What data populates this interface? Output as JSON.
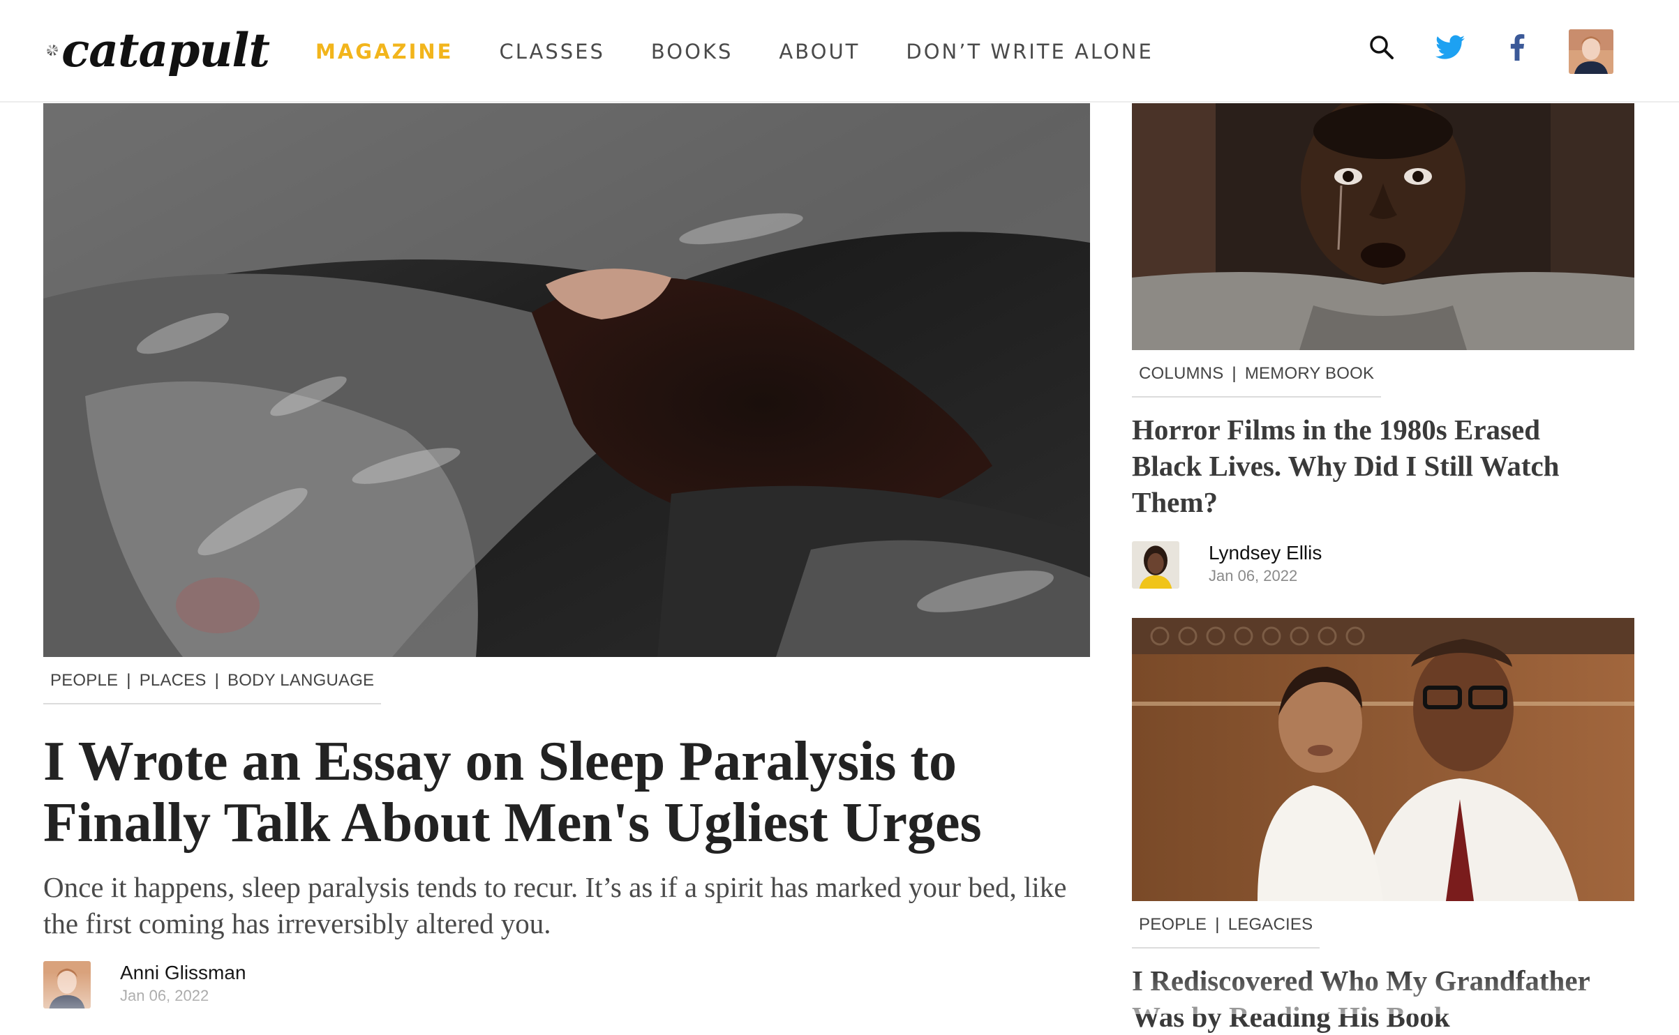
{
  "header": {
    "logo_text": "catapult",
    "nav": [
      {
        "label": "MAGAZINE",
        "active": true
      },
      {
        "label": "CLASSES",
        "active": false
      },
      {
        "label": "BOOKS",
        "active": false
      },
      {
        "label": "ABOUT",
        "active": false
      },
      {
        "label": "DON’T WRITE ALONE",
        "active": false
      }
    ],
    "icons": [
      "search-icon",
      "twitter-icon",
      "facebook-icon",
      "user-avatar"
    ]
  },
  "hero": {
    "tags": [
      "PEOPLE",
      "PLACES",
      "BODY LANGUAGE"
    ],
    "title": "I Wrote an Essay on Sleep Paralysis to Finally Talk About Men's Ugliest Urges",
    "dek": "Once it happens, sleep paralysis tends to recur. It’s as if a spirit has marked your bed, like the first coming has irreversibly altered you.",
    "author": {
      "name": "Anni Glissman",
      "date": "Jan 06, 2022"
    }
  },
  "sidebar": [
    {
      "tags": [
        "COLUMNS",
        "MEMORY BOOK"
      ],
      "title": "Horror Films in the 1980s Erased Black Lives. Why Did I Still Watch Them?",
      "author": {
        "name": "Lyndsey Ellis",
        "date": "Jan 06, 2022"
      }
    },
    {
      "tags": [
        "PEOPLE",
        "LEGACIES"
      ],
      "title": "I Rediscovered Who My Grandfather Was by Reading His Book"
    }
  ],
  "colors": {
    "accent": "#f2b51c",
    "nav_text": "#4a4a4a",
    "twitter": "#1da1f2",
    "facebook": "#3b5998",
    "title_text": "#222222"
  }
}
